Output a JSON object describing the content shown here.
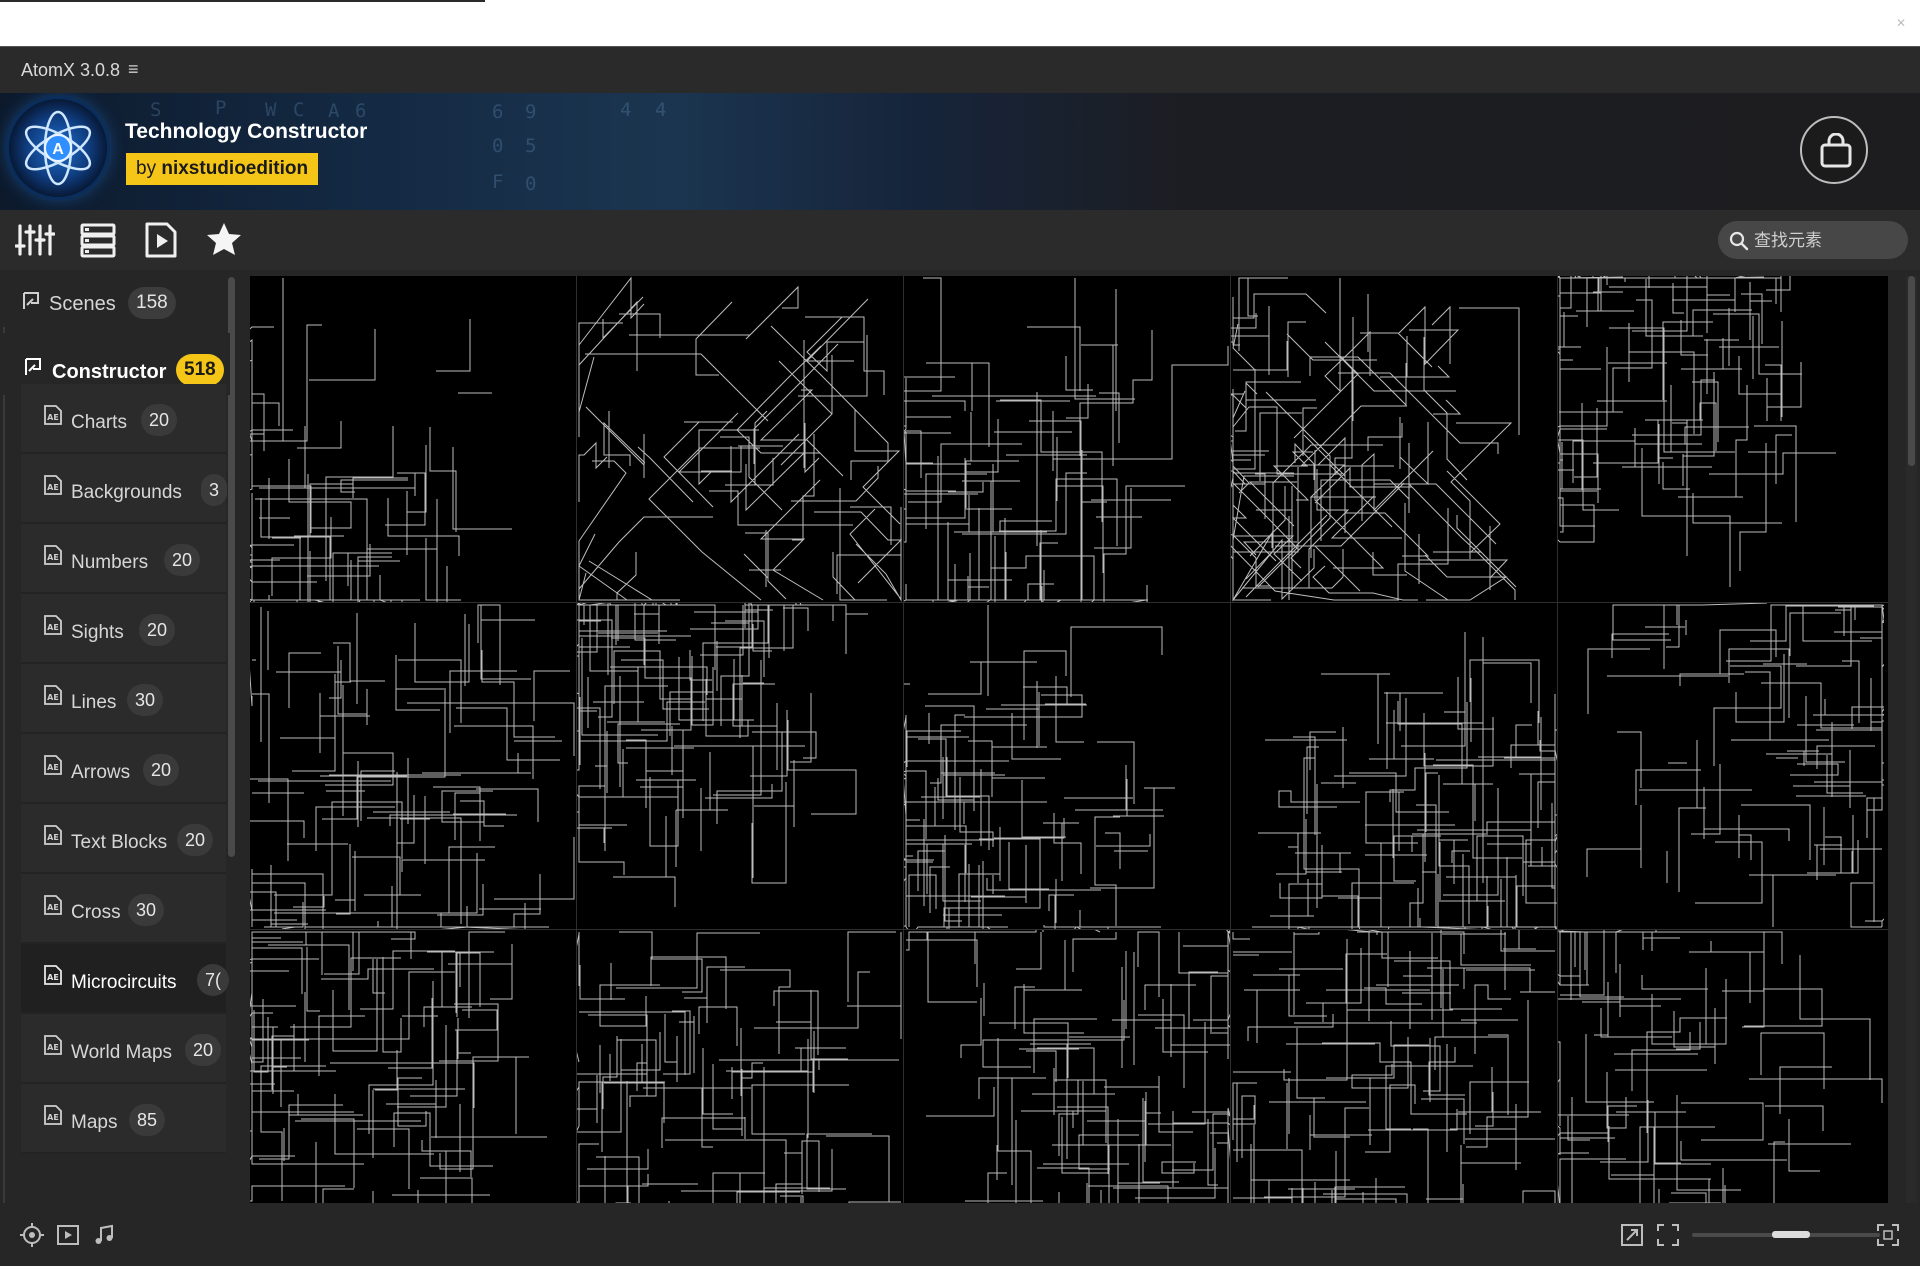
{
  "app": {
    "title": "AtomX 3.0.8",
    "menu_glyph": "≡"
  },
  "pack": {
    "title": "Technology Constructor",
    "by_prefix": "by",
    "author": "nixstudioedition"
  },
  "banner_deco": [
    "S",
    "P",
    "W",
    "C",
    "F",
    "A",
    "6",
    "0",
    "6",
    "9",
    "4",
    "4",
    "0",
    "5",
    "F",
    "0"
  ],
  "toolbar": {
    "buttons": [
      {
        "name": "settings-sliders-button",
        "icon": "sliders-icon"
      },
      {
        "name": "list-view-button",
        "icon": "list-icon"
      },
      {
        "name": "preview-button",
        "icon": "play-file-icon"
      },
      {
        "name": "favorites-button",
        "icon": "star-icon"
      }
    ],
    "search": {
      "placeholder": "查找元素",
      "value": ""
    }
  },
  "sidebar": {
    "top": [
      {
        "label": "Scenes",
        "count": "158",
        "active": false
      },
      {
        "label": "Constructor",
        "count": "518",
        "active": true
      }
    ],
    "items": [
      {
        "label": "Charts",
        "count": "20"
      },
      {
        "label": "Backgrounds",
        "count": "3"
      },
      {
        "label": "Numbers",
        "count": "20"
      },
      {
        "label": "Sights",
        "count": "20"
      },
      {
        "label": "Lines",
        "count": "30"
      },
      {
        "label": "Arrows",
        "count": "20"
      },
      {
        "label": "Text Blocks",
        "count": "20"
      },
      {
        "label": "Cross",
        "count": "30"
      },
      {
        "label": "Microcircuits",
        "count": "7(",
        "active": true
      },
      {
        "label": "World Maps",
        "count": "20"
      },
      {
        "label": "Maps",
        "count": "85"
      }
    ]
  },
  "grid": {
    "columns": 5,
    "rows": 3,
    "tile_count": 15
  },
  "status": {
    "icons": [
      "target-icon",
      "video-icon",
      "music-icon"
    ],
    "right_icons": [
      "expand-icon",
      "fit-icon",
      "fullscreen-icon"
    ],
    "zoom_level": 0.5
  },
  "colors": {
    "accent": "#f5c518",
    "background": "#262626",
    "tile": "#000000"
  }
}
